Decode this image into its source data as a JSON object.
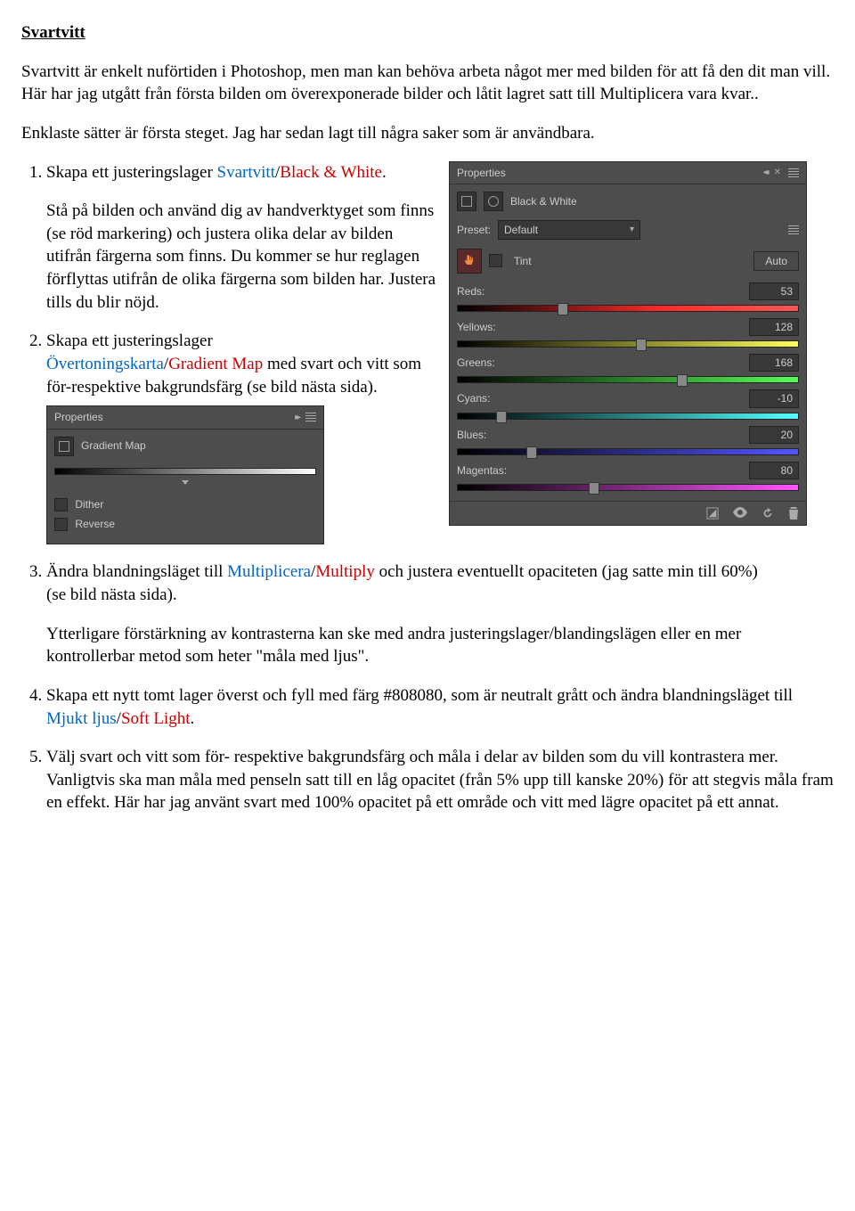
{
  "title": "Svartvitt",
  "intro1": "Svartvitt är enkelt  nuförtiden i Photoshop, men man kan behöva arbeta något mer med bilden för att få den dit man vill. Här har jag utgått från första bilden om överexponerade bilder och låtit lagret satt till Multiplicera vara kvar..",
  "intro2": "Enklaste sätter är första steget. Jag har sedan lagt till några saker som är användbara.",
  "step1_a": "Skapa ett justeringslager ",
  "step1_b": "Svartvitt",
  "step1_c": "Black & White",
  "step1_block": "Stå på bilden och använd dig av handverktyget som finns (se röd markering) och justera olika delar av bilden utifrån färgerna som finns. Du kommer se hur reglagen förflyttas utifrån de olika färgerna som bilden har. Justera tills du blir nöjd.",
  "step2_a": "Skapa ett justeringslager ",
  "step2_b": "Övertoningskarta",
  "step2_c": "Gradient Map",
  "step2_d": " med svart och vitt som för-respektive bakgrundsfärg (se bild nästa sida).",
  "step3_a": "Ändra blandningsläget till ",
  "step3_b": "Multiplicera",
  "step3_c": "Multiply",
  "step3_d_1": " och justera eventuellt opaciteten (jag satte min till 60%)",
  "step3_d_2": "(se bild nästa sida).",
  "step3_note": "Ytterligare förstärkning av kontrasterna kan ske med andra justeringslager/blandingslägen eller en mer kontrollerbar metod som heter \"måla med ljus\".",
  "step4_a": "Skapa ett nytt tomt lager överst och fyll med färg #808080, som är neutralt grått och ändra blandningsläget till ",
  "step4_b": "Mjukt ljus",
  "step4_c": "Soft Light",
  "step5_a": "Välj svart och vitt som för- respektive bakgrundsfärg och måla i delar av bilden som du vill kontrastera mer.",
  "step5_b": "Vanligtvis ska man måla med penseln satt till en låg opacitet (från 5% upp till kanske 20%) för att stegvis måla fram en effekt. Här har jag använt svart med 100% opacitet på ett område och vitt med lägre opacitet på ett annat.",
  "bw_panel": {
    "tab": "Properties",
    "title": "Black & White",
    "preset_label": "Preset:",
    "preset_value": "Default",
    "tint_label": "Tint",
    "auto_label": "Auto",
    "sliders": [
      {
        "label": "Reds:",
        "value": "53",
        "pos": 31,
        "grad": "grad-red"
      },
      {
        "label": "Yellows:",
        "value": "128",
        "pos": 54,
        "grad": "grad-yellow"
      },
      {
        "label": "Greens:",
        "value": "168",
        "pos": 66,
        "grad": "grad-green"
      },
      {
        "label": "Cyans:",
        "value": "-10",
        "pos": 13,
        "grad": "grad-cyan"
      },
      {
        "label": "Blues:",
        "value": "20",
        "pos": 22,
        "grad": "grad-blue"
      },
      {
        "label": "Magentas:",
        "value": "80",
        "pos": 40,
        "grad": "grad-magenta"
      }
    ]
  },
  "gm_panel": {
    "tab": "Properties",
    "title": "Gradient Map",
    "dither": "Dither",
    "reverse": "Reverse"
  }
}
